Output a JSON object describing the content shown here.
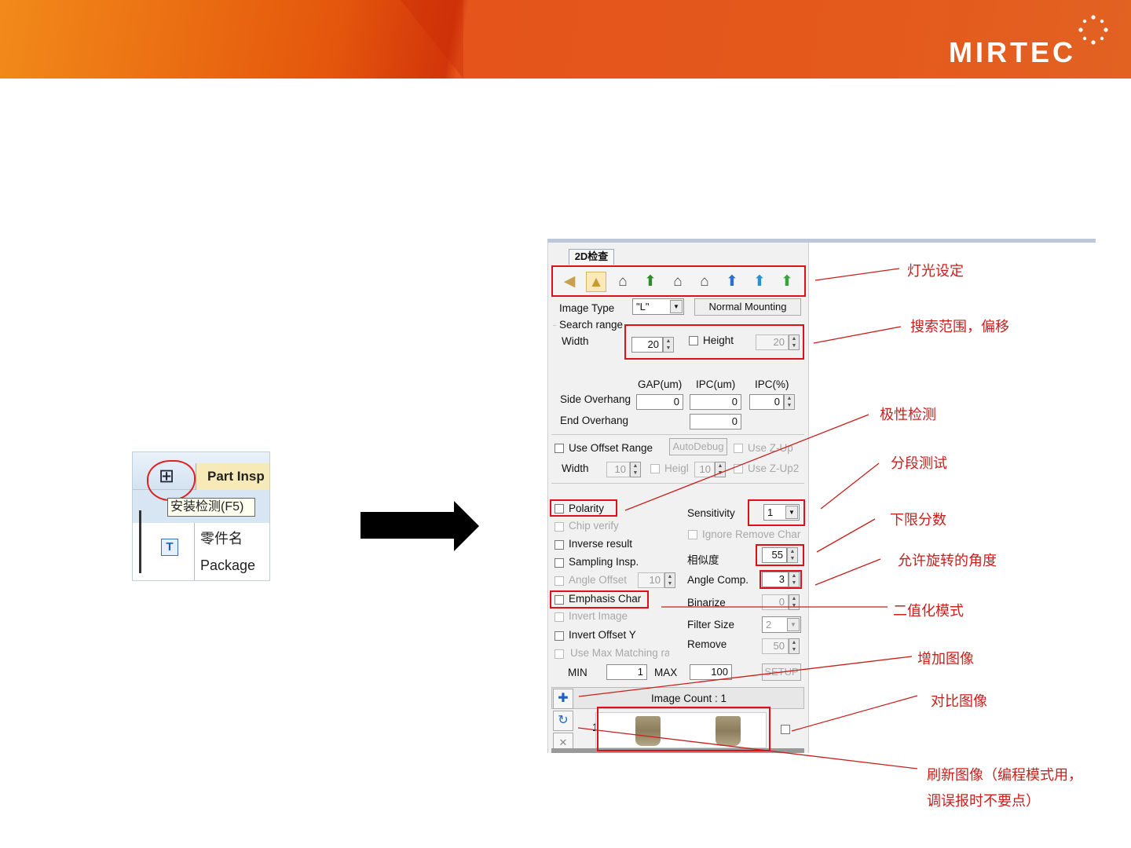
{
  "brand": {
    "logo_text": "MIRTEC"
  },
  "left_snippet": {
    "icon_glyph": "⊞",
    "part_tab": "Part Insp",
    "tooltip": "安装检测(F5)",
    "icon_t": "T",
    "col_name": "零件名",
    "col_package": "Package"
  },
  "dialog": {
    "tab_title": "2D检查",
    "light_buttons": [
      "speaker-icon",
      "lamp-icon",
      "house-H-icon",
      "arrow-up-icon",
      "house-V-icon",
      "house-C-icon",
      "arrow-blue-icon",
      "arrow-blue2-icon",
      "arrow-green-icon"
    ],
    "image_type_label": "Image Type",
    "image_type_value": "\"L\"",
    "mounting_button": "Normal Mounting",
    "search_range_label": "Search range",
    "width_label": "Width",
    "width_value": "20",
    "height_label": "Height",
    "height_value": "20",
    "gap_header": "GAP(um)",
    "ipc_um_header": "IPC(um)",
    "ipc_pct_header": "IPC(%)",
    "side_overhang_label": "Side Overhang",
    "side_gap": "0",
    "side_ipc_um": "0",
    "side_ipc_pct": "0",
    "end_overhang_label": "End Overhang",
    "end_ipc_um": "0",
    "use_offset_range_label": "Use Offset Range",
    "autodebug_button": "AutoDebug",
    "use_zup_label": "Use Z-Up",
    "offset_width_label": "Width",
    "offset_width_value": "10",
    "offset_height_label": "Heigl",
    "offset_height_value": "10",
    "use_zup2_label": "Use Z-Up2",
    "polarity_label": "Polarity",
    "sensitivity_label": "Sensitivity",
    "sensitivity_value": "1",
    "chip_verify_label": "Chip verify",
    "ignore_remove_char_label": "Ignore Remove Char",
    "inverse_result_label": "Inverse result",
    "similarity_label": "相似度",
    "similarity_value": "55",
    "sampling_insp_label": "Sampling Insp.",
    "angle_offset_label": "Angle Offset",
    "angle_offset_value": "10",
    "angle_comp_label": "Angle Comp.",
    "angle_comp_value": "3",
    "emphasis_char_label": "Emphasis Char",
    "binarize_label": "Binarize",
    "binarize_value": "0",
    "invert_image_label": "Invert Image",
    "filter_size_label": "Filter Size",
    "filter_size_value": "2",
    "invert_offset_y_label": "Invert Offset Y",
    "remove_label": "Remove",
    "remove_value": "50",
    "use_max_matching_label": "Use Max Matching ra",
    "min_label": "MIN",
    "min_value": "1",
    "max_label": "MAX",
    "max_value": "100",
    "setup_button": "SETUP",
    "image_count_text": "Image Count : 1",
    "thumb_index": "1"
  },
  "annotations": {
    "light_setting": "灯光设定",
    "search_range_offset": "搜索范围，偏移",
    "polarity_check": "极性检测",
    "segment_test": "分段测试",
    "lower_limit_score": "下限分数",
    "allowed_rotation": "允许旋转的角度",
    "binarize_mode": "二值化模式",
    "add_image": "增加图像",
    "compare_image": "对比图像",
    "refresh_image_line1": "刷新图像（编程模式用，",
    "refresh_image_line2": "调误报时不要点）"
  },
  "colors": {
    "annotation_red": "#c8201c",
    "highlight_red": "#e0101a",
    "banner_orange": "#e4561c"
  }
}
